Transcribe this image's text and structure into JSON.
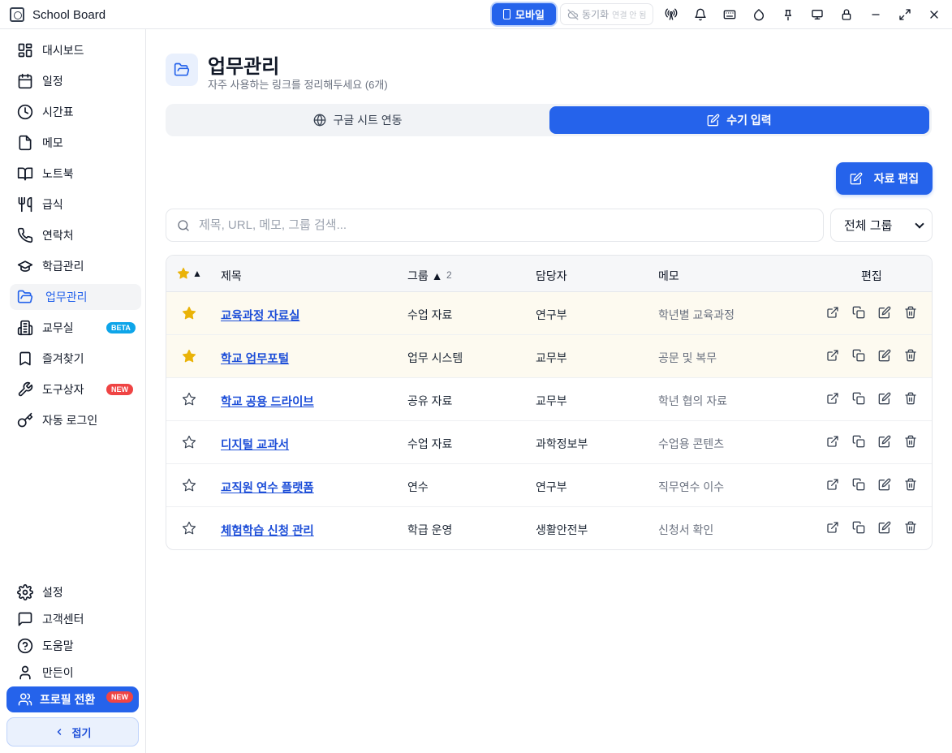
{
  "app": {
    "title": "School Board"
  },
  "titlebar": {
    "mobile_label": "모바일",
    "sync_label": "동기화",
    "sync_status": "연결 안 됨"
  },
  "sidebar": {
    "items": [
      {
        "label": "대시보드",
        "icon": "dashboard-icon"
      },
      {
        "label": "일정",
        "icon": "calendar-icon"
      },
      {
        "label": "시간표",
        "icon": "clock-icon"
      },
      {
        "label": "메모",
        "icon": "note-icon"
      },
      {
        "label": "노트북",
        "icon": "book-icon"
      },
      {
        "label": "급식",
        "icon": "utensils-icon"
      },
      {
        "label": "연락처",
        "icon": "phone-icon"
      },
      {
        "label": "학급관리",
        "icon": "graduation-cap-icon"
      },
      {
        "label": "업무관리",
        "icon": "folder-icon",
        "active": true
      },
      {
        "label": "교무실",
        "icon": "building-icon",
        "badge": "BETA"
      },
      {
        "label": "즐겨찾기",
        "icon": "bookmark-icon"
      },
      {
        "label": "도구상자",
        "icon": "wrench-icon",
        "badge": "NEW"
      },
      {
        "label": "자동 로그인",
        "icon": "key-icon"
      }
    ],
    "bottom_items": [
      {
        "label": "설정",
        "icon": "gear-icon"
      },
      {
        "label": "고객센터",
        "icon": "message-icon"
      },
      {
        "label": "도움말",
        "icon": "help-icon"
      },
      {
        "label": "만든이",
        "icon": "user-icon"
      }
    ],
    "profile_switch": {
      "label": "프로필 전환",
      "badge": "NEW"
    },
    "collapse_label": "접기"
  },
  "main": {
    "title": "업무관리",
    "subtitle": "자주 사용하는 링크를 정리해두세요 (6개)",
    "tabs": [
      {
        "label": "구글 시트 연동",
        "icon": "globe-icon"
      },
      {
        "label": "수기 입력",
        "icon": "edit-icon",
        "active": true
      }
    ],
    "edit_data_label": "자료 편집",
    "search": {
      "placeholder": "제목, URL, 메모, 그룹 검색...",
      "value": ""
    },
    "group_filter": {
      "selected": "전체 그룹"
    },
    "table": {
      "headers": {
        "star_sort": "▲",
        "title": "제목",
        "group": "그룹 ▲",
        "group_sort_order": "2",
        "owner": "담당자",
        "memo": "메모",
        "edit": "편집"
      },
      "rows": [
        {
          "starred": true,
          "title": "교육과정 자료실",
          "group": "수업 자료",
          "owner": "연구부",
          "memo": "학년별 교육과정"
        },
        {
          "starred": true,
          "title": "학교 업무포털",
          "group": "업무 시스템",
          "owner": "교무부",
          "memo": "공문 및 복무"
        },
        {
          "starred": false,
          "title": "학교 공용 드라이브",
          "group": "공유 자료",
          "owner": "교무부",
          "memo": "학년 협의 자료"
        },
        {
          "starred": false,
          "title": "디지털 교과서",
          "group": "수업 자료",
          "owner": "과학정보부",
          "memo": "수업용 콘텐츠"
        },
        {
          "starred": false,
          "title": "교직원 연수 플랫폼",
          "group": "연수",
          "owner": "연구부",
          "memo": "직무연수 이수"
        },
        {
          "starred": false,
          "title": "체험학습 신청 관리",
          "group": "학급 운영",
          "owner": "생활안전부",
          "memo": "신청서 확인"
        }
      ],
      "row_actions": [
        "external-link-icon",
        "copy-icon",
        "edit-icon",
        "trash-icon"
      ]
    }
  },
  "colors": {
    "accent": "#2563eb",
    "star": "#eab308",
    "beta_badge": "#0ea5e9",
    "new_badge": "#ef4444"
  }
}
